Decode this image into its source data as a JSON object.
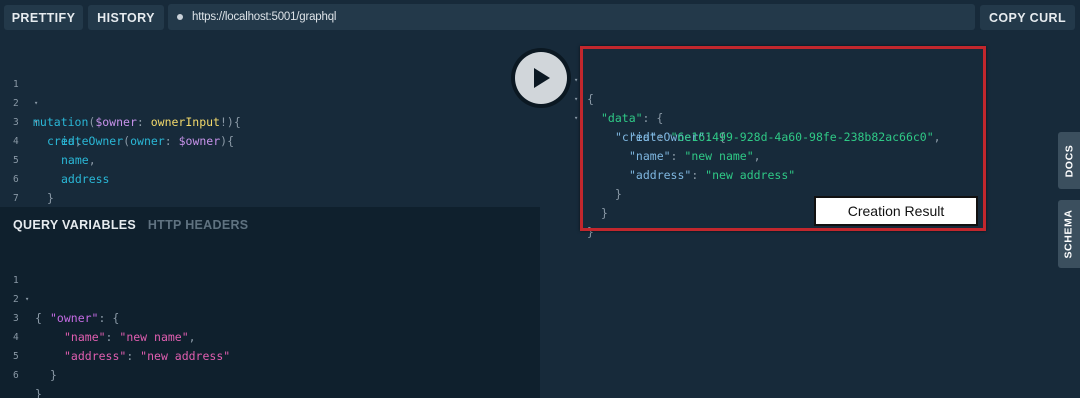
{
  "toolbar": {
    "prettify_label": "PRETTIFY",
    "history_label": "HISTORY",
    "url": "https://localhost:5001/graphql",
    "copy_curl_label": "COPY CURL"
  },
  "query_editor": {
    "line_numbers": [
      "1",
      "2",
      "3",
      "4",
      "5",
      "6",
      "7"
    ],
    "l1": {
      "kw": "mutation",
      "p1": "(",
      "var": "$owner",
      "p2": ": ",
      "type": "ownerInput",
      "p3": "!){"
    },
    "l2": {
      "fn": "createOwner",
      "p1": "(",
      "arg": "owner",
      "p2": ": ",
      "var": "$owner",
      "p3": "){"
    },
    "l3": {
      "fld": "id",
      "p": ","
    },
    "l4": {
      "fld": "name",
      "p": ","
    },
    "l5": {
      "fld": "address"
    },
    "l6": {
      "p": "}"
    },
    "l7": {
      "p": "}"
    }
  },
  "variables_panel": {
    "tab_query_variables": "QUERY VARIABLES",
    "tab_http_headers": "HTTP HEADERS",
    "line_numbers": [
      "1",
      "2",
      "3",
      "4",
      "5",
      "6"
    ],
    "l1": {
      "p": "{"
    },
    "l2": {
      "key": "\"owner\"",
      "p": ": {"
    },
    "l3": {
      "key": "\"name\"",
      "p1": ": ",
      "str": "\"new name\"",
      "p2": ","
    },
    "l4": {
      "key": "\"address\"",
      "p1": ": ",
      "str": "\"new address\""
    },
    "l5": {
      "p": "}"
    },
    "l6": {
      "p": "}"
    }
  },
  "result_panel": {
    "l1": {
      "p": "{"
    },
    "l2": {
      "key": "\"data\"",
      "p": ": {"
    },
    "l3": {
      "key": "\"createOwner\"",
      "p": ": {"
    },
    "l4": {
      "key": "\"id\"",
      "p1": ": ",
      "str": "\"6e161499-928d-4a60-98fe-238b82ac66c0\"",
      "p2": ","
    },
    "l5": {
      "key": "\"name\"",
      "p1": ": ",
      "str": "\"new name\"",
      "p2": ","
    },
    "l6": {
      "key": "\"address\"",
      "p1": ": ",
      "str": "\"new address\""
    },
    "l7": {
      "p": "}"
    },
    "l8": {
      "p": "}"
    },
    "l9": {
      "p": "}"
    },
    "annotation": "Creation Result"
  },
  "side_tabs": {
    "docs": "DOCS",
    "schema": "SCHEMA"
  },
  "icons": {
    "run": "play-icon",
    "fold": "fold-arrow-icon",
    "url_status": "status-dot-icon"
  },
  "colors": {
    "background": "#172a3a",
    "variables_background": "#0f202d",
    "highlight_border": "#c2272d",
    "string": "#2fc986",
    "keyword": "#2ab7d6",
    "variable_key": "#e05eb0"
  }
}
